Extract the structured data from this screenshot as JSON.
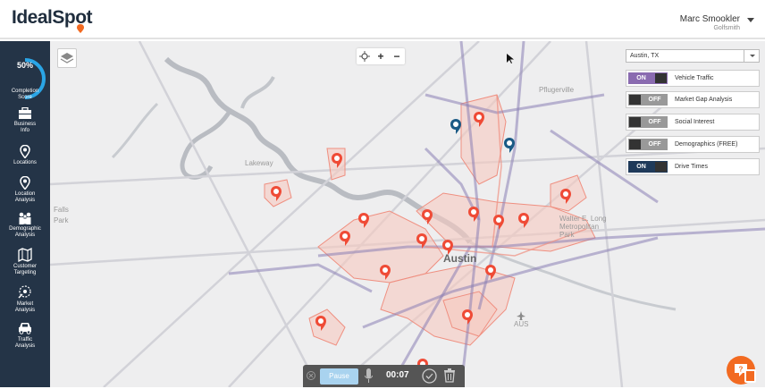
{
  "brand": {
    "logo_part1": "Ideal",
    "logo_part2": "Spot",
    "accent_color": "#f26a21"
  },
  "user": {
    "name": "Marc Smookler",
    "company": "Golfsmith"
  },
  "sidebar": {
    "score_value": 0.5,
    "score_text": "50%",
    "score_label_line1": "Completion",
    "score_label_line2": "Score",
    "items": [
      {
        "line1": "Business",
        "line2": "Info",
        "icon": "briefcase-icon"
      },
      {
        "line1": "Locations",
        "line2": "",
        "icon": "location-pin-icon"
      },
      {
        "line1": "Location",
        "line2": "Analysis",
        "icon": "location-analysis-icon"
      },
      {
        "line1": "Demographic",
        "line2": "Analysis",
        "icon": "people-icon"
      },
      {
        "line1": "Customer",
        "line2": "Targeting",
        "icon": "map-target-icon"
      },
      {
        "line1": "Market",
        "line2": "Analysis",
        "icon": "market-icon"
      },
      {
        "line1": "Traffic",
        "line2": "Analysis",
        "icon": "car-icon"
      }
    ]
  },
  "map": {
    "labels": {
      "pflugerville": "Pflugerville",
      "lakeway": "Lakeway",
      "austin": "Austin",
      "aus": "AUS",
      "falls": "Falls",
      "park": "Park",
      "walter": "Walter E. Long",
      "metro": "Metropolitan",
      "park2": "Park"
    }
  },
  "controls": {
    "city_select": "Austin, TX",
    "layers": [
      {
        "state": "ON",
        "label": "Vehicle Traffic",
        "on_color": "#8a6bb0"
      },
      {
        "state": "OFF",
        "label": "Market Gap Analysis"
      },
      {
        "state": "OFF",
        "label": "Social Interest"
      },
      {
        "state": "OFF",
        "label": "Demographics (FREE)"
      },
      {
        "state": "ON",
        "label": "Drive Times",
        "on_color": "#1f3a5a"
      }
    ]
  },
  "recorder": {
    "pause_label": "Pause",
    "time": "00:07"
  }
}
